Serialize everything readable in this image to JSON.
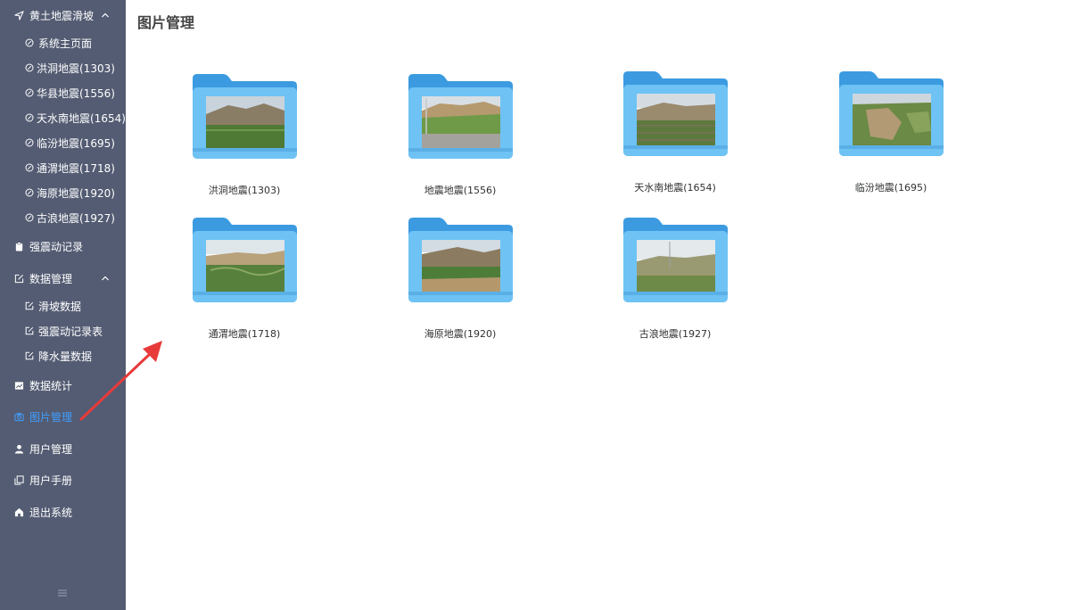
{
  "sidebar": {
    "group_title": "黄土地震滑坡",
    "group_items": [
      {
        "label": "系统主页面",
        "icon": "check-circle-icon"
      },
      {
        "label": "洪洞地震(1303)",
        "icon": "check-circle-icon"
      },
      {
        "label": "华县地震(1556)",
        "icon": "check-circle-icon"
      },
      {
        "label": "天水南地震(1654)",
        "icon": "check-circle-icon"
      },
      {
        "label": "临汾地震(1695)",
        "icon": "check-circle-icon"
      },
      {
        "label": "通渭地震(1718)",
        "icon": "check-circle-icon"
      },
      {
        "label": "海原地震(1920)",
        "icon": "check-circle-icon"
      },
      {
        "label": "古浪地震(1927)",
        "icon": "check-circle-icon"
      }
    ],
    "strong_motion": "强震动记录",
    "data_mgmt": {
      "title": "数据管理",
      "items": [
        "滑坡数据",
        "强震动记录表",
        "降水量数据"
      ]
    },
    "stats": "数据统计",
    "images": "图片管理",
    "users": "用户管理",
    "manual": "用户手册",
    "logout": "退出系统"
  },
  "main": {
    "title": "图片管理",
    "folders": [
      {
        "caption": "洪洞地震(1303)"
      },
      {
        "caption": "地震地震(1556)"
      },
      {
        "caption": "天水南地震(1654)"
      },
      {
        "caption": "临汾地震(1695)"
      },
      {
        "caption": "通渭地震(1718)"
      },
      {
        "caption": "海原地震(1920)"
      },
      {
        "caption": "古浪地震(1927)"
      }
    ]
  },
  "colors": {
    "sidebar_bg": "#545c73",
    "active": "#409eff",
    "folder": "#5ab4ec",
    "annotation_arrow": "#e83a3a"
  }
}
